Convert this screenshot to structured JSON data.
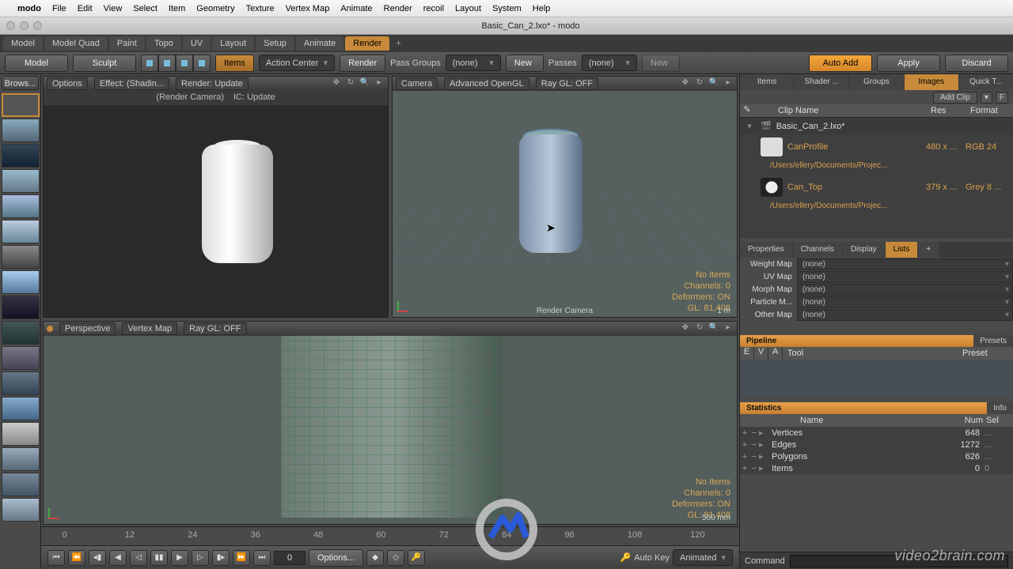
{
  "menubar": {
    "app": "modo",
    "items": [
      "File",
      "Edit",
      "View",
      "Select",
      "Item",
      "Geometry",
      "Texture",
      "Vertex Map",
      "Animate",
      "Render",
      "recoil",
      "Layout",
      "System",
      "Help"
    ]
  },
  "window_title": "Basic_Can_2.lxo* - modo",
  "layout_tabs": {
    "items": [
      "Model",
      "Model Quad",
      "Paint",
      "Topo",
      "UV",
      "Layout",
      "Setup",
      "Animate",
      "Render"
    ],
    "active": "Render"
  },
  "toolbar": {
    "model": "Model",
    "sculpt": "Sculpt",
    "items": "Items",
    "action_center": "Action Center",
    "render": "Render",
    "pass_groups": "Pass Groups",
    "pg_val": "(none)",
    "new1": "New",
    "passes": "Passes",
    "p_val": "(none)",
    "new2": "New",
    "auto_add": "Auto Add",
    "apply": "Apply",
    "discard": "Discard"
  },
  "browser": {
    "label": "Brows..."
  },
  "viewport1": {
    "options": "Options",
    "effect": "Effect: (Shadin...",
    "render": "Render: Update",
    "camera": "(Render Camera)",
    "ic": "IC: Update"
  },
  "viewport2": {
    "camera": "Camera",
    "mode": "Advanced OpenGL",
    "raygl": "Ray GL: OFF",
    "info": {
      "noitems": "No Items",
      "channels": "Channels: 0",
      "deformers": "Deformers: ON",
      "gl": "GL: 81,408"
    },
    "bottom": "Render Camera",
    "scale": "1 m"
  },
  "viewport3": {
    "persp": "Perspective",
    "vmap": "Vertex Map",
    "raygl": "Ray GL: OFF",
    "info": {
      "noitems": "No Items",
      "channels": "Channels: 0",
      "deformers": "Deformers: ON",
      "gl": "GL: 81,408"
    },
    "scale": "500 mm"
  },
  "timeline": {
    "marks": [
      "0",
      "12",
      "24",
      "36",
      "48",
      "60",
      "72",
      "84",
      "96",
      "108",
      "120"
    ],
    "sub": "120"
  },
  "transport": {
    "frame": "0",
    "options": "Options...",
    "autokey": "Auto Key",
    "animated": "Animated"
  },
  "right": {
    "tabs_top": {
      "items": [
        "Items",
        "Shader ...",
        "Groups",
        "Images",
        "Quick T..."
      ],
      "active": "Images"
    },
    "add_clip": "Add Clip",
    "clip_cols": {
      "c1": "Clip Name",
      "c2": "Res",
      "c3": "Format"
    },
    "root": "Basic_Can_2.lxo*",
    "clips": [
      {
        "name": "CanProfile",
        "res": "480 x  ...",
        "fmt": "RGB 24",
        "path": "/Users/ellery/Documents/Projec..."
      },
      {
        "name": "Can_Top",
        "res": "379 x  ...",
        "fmt": "Grey 8 ...",
        "path": "/Users/ellery/Documents/Projec..."
      }
    ],
    "tabs_mid": {
      "items": [
        "Properties",
        "Channels",
        "Display",
        "Lists"
      ],
      "active": "Lists"
    },
    "maps": [
      {
        "label": "Weight Map",
        "val": "(none)"
      },
      {
        "label": "UV Map",
        "val": "(none)"
      },
      {
        "label": "Morph Map",
        "val": "(none)"
      },
      {
        "label": "Particle M...",
        "val": "(none)"
      },
      {
        "label": "Other Map",
        "val": "(none)"
      }
    ],
    "pipeline": {
      "label": "Pipeline",
      "sub": "Presets",
      "cols": {
        "e": "E",
        "v": "V",
        "a": "A",
        "tool": "Tool",
        "preset": "Preset"
      }
    },
    "stats": {
      "label": "Statistics",
      "sub": "Info",
      "cols": {
        "name": "Name",
        "num": "Num",
        "sel": "Sel"
      },
      "rows": [
        {
          "name": "Vertices",
          "num": "648",
          "sel": "..."
        },
        {
          "name": "Edges",
          "num": "1272",
          "sel": "..."
        },
        {
          "name": "Polygons",
          "num": "626",
          "sel": "..."
        },
        {
          "name": "Items",
          "num": "0",
          "sel": "0"
        }
      ]
    },
    "command_label": "Command"
  },
  "watermark": "video2brain.com"
}
